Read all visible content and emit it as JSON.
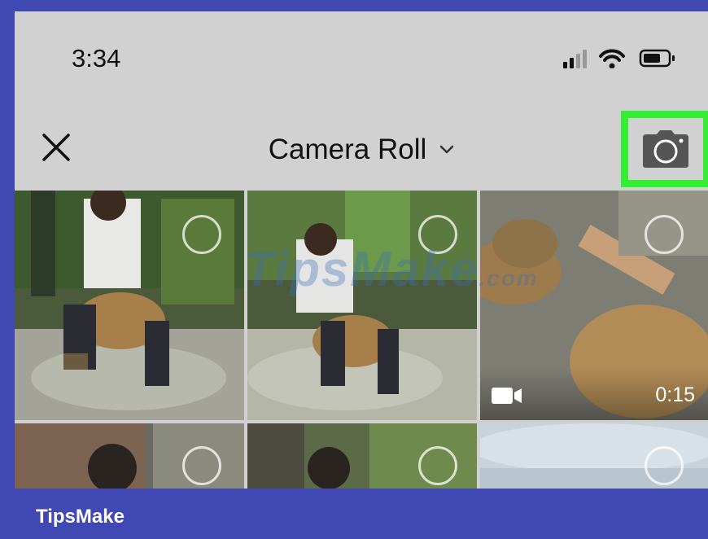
{
  "status_bar": {
    "time": "3:34",
    "icons": [
      "cellular-signal-icon",
      "wifi-icon",
      "battery-icon"
    ]
  },
  "nav": {
    "close_icon": "close-icon",
    "title": "Camera Roll",
    "title_dropdown_icon": "chevron-down-icon",
    "camera_icon": "camera-icon",
    "highlight_color": "#33ee33"
  },
  "grid": {
    "items": [
      {
        "type": "photo"
      },
      {
        "type": "photo"
      },
      {
        "type": "video",
        "duration": "0:15"
      },
      {
        "type": "photo"
      },
      {
        "type": "photo"
      },
      {
        "type": "photo"
      }
    ]
  },
  "watermark": {
    "text": "TipsMake",
    "suffix": ".com"
  },
  "footer": {
    "brand": "TipsMake",
    "color": "#3f48b3"
  }
}
